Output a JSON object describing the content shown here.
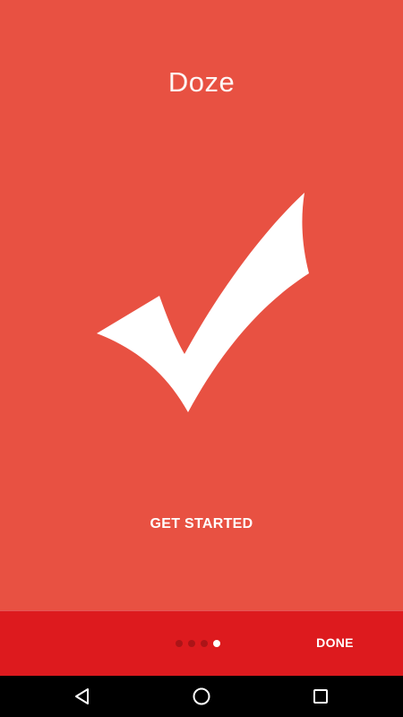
{
  "app": {
    "title": "Doze"
  },
  "content": {
    "hero_icon": "checkmark-icon",
    "get_started_label": "GET STARTED"
  },
  "bottom_bar": {
    "pager_total": 4,
    "pager_active_index": 3,
    "done_label": "DONE"
  },
  "nav_bar": {
    "icons": [
      "back-icon",
      "home-icon",
      "recents-icon"
    ]
  },
  "colors": {
    "background": "#E85142",
    "bottom_bar": "#DD1A1E",
    "nav_bar": "#000000",
    "foreground": "#FFFFFF"
  }
}
